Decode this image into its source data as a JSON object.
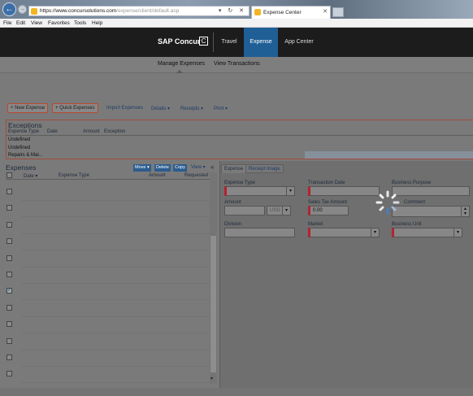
{
  "browser": {
    "url_prefix": "https://",
    "url_host": "www.concursolutions.com",
    "url_path": "/expense/client/default.asp",
    "tab_title": "Expense Center",
    "address_controls": "▾ ↻ ✕",
    "menu": [
      "File",
      "Edit",
      "View",
      "Favorites",
      "Tools",
      "Help"
    ]
  },
  "header": {
    "logo": "SAP Concur",
    "logo_mark": "C",
    "tabs": [
      "Travel",
      "Expense",
      "App Center"
    ],
    "active_tab": "Expense"
  },
  "subnav": {
    "items": [
      "Manage Expenses",
      "View Transactions"
    ],
    "active": "Manage Expenses"
  },
  "toolbar": {
    "new_expense": "+ New Expense",
    "quick_expenses": "+ Quick Expenses",
    "import_expenses": "Import Expenses",
    "details": "Details ▾",
    "receipts": "Receipts ▾",
    "print": "Print ▾"
  },
  "exceptions": {
    "title": "Exceptions",
    "columns": [
      "Expense Type",
      "Date",
      "Amount",
      "Exception"
    ],
    "rows": [
      "Undefined",
      "Undefined",
      "Repairs & Mai..."
    ]
  },
  "expenses": {
    "title": "Expenses",
    "buttons": {
      "move": "Move ▾",
      "delete": "Delete",
      "copy": "Copy"
    },
    "view": "View ▾",
    "collapse": "«",
    "columns": {
      "date": "Date ▾",
      "type": "Expense Type",
      "amount": "Amount",
      "requested": "Requested"
    },
    "row_count": 12,
    "checked_row": 7
  },
  "form": {
    "tabs": {
      "expense": "Expense",
      "receipt": "Receipt Image"
    },
    "expense_type_label": "Expense Type",
    "transaction_date_label": "Transaction Date",
    "business_purpose_label": "Business Purpose",
    "amount_label": "Amount",
    "currency": "USD",
    "sales_tax_label": "Sales Tax Amount",
    "sales_tax_value": "0.00",
    "comment_label": "Comment",
    "division_label": "Division",
    "market_label": "Market",
    "business_unit_label": "Business Unit"
  },
  "colors": {
    "header_bg": "#1c1c1c",
    "active_tab": "#1f5f96",
    "required": "#b3232f",
    "button_blue": "#2c5d8f"
  },
  "icons": [
    "back-arrow-icon",
    "forward-arrow-icon",
    "favicon-icon",
    "spinner-icon",
    "checkbox-icon",
    "chevron-down-icon"
  ]
}
